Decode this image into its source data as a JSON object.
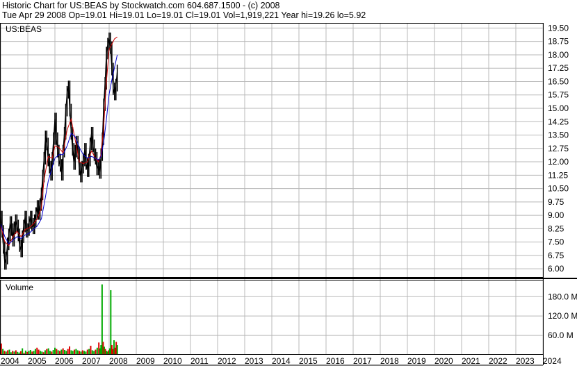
{
  "header": {
    "line1": "Historic Chart for US:BEAS by Stockwatch.com 604.687.1500 - (c) 2008",
    "line2": "Tue Apr 29 2008   Op=19.01   Hi=19.01   Lo=19.01   Cl=19.01   Vol=1,919,221   Year hi=19.26   lo=5.92"
  },
  "chart_data": [
    {
      "type": "line",
      "title": "US:BEAS",
      "y_ticks": [
        "19.50",
        "18.75",
        "18.00",
        "17.25",
        "16.50",
        "15.75",
        "15.00",
        "14.25",
        "13.50",
        "12.75",
        "12.00",
        "11.25",
        "10.50",
        "9.75",
        "9.00",
        "8.25",
        "7.50",
        "6.75",
        "6.00"
      ],
      "ylim": [
        5.5,
        19.75
      ],
      "grid": true,
      "colors": {
        "price": "#000000",
        "ma_short": "#cc0000",
        "ma_long": "#0000cc"
      },
      "series": [
        {
          "key": "price",
          "x": [
            2004.0,
            2004.05,
            2004.1,
            2004.15,
            2004.2,
            2004.25,
            2004.3,
            2004.35,
            2004.4,
            2004.45,
            2004.5,
            2004.55,
            2004.6,
            2004.65,
            2004.7,
            2004.75,
            2004.8,
            2004.85,
            2004.9,
            2004.95,
            2005.0,
            2005.05,
            2005.1,
            2005.15,
            2005.2,
            2005.25,
            2005.3,
            2005.35,
            2005.4,
            2005.45,
            2005.5,
            2005.55,
            2005.6,
            2005.65,
            2005.7,
            2005.75,
            2005.8,
            2005.85,
            2005.9,
            2005.95,
            2006.0,
            2006.05,
            2006.1,
            2006.15,
            2006.2,
            2006.25,
            2006.3,
            2006.35,
            2006.4,
            2006.45,
            2006.5,
            2006.55,
            2006.6,
            2006.65,
            2006.7,
            2006.75,
            2006.8,
            2006.85,
            2006.9,
            2006.95,
            2007.0,
            2007.05,
            2007.1,
            2007.15,
            2007.2,
            2007.25,
            2007.3,
            2007.35,
            2007.4,
            2007.45,
            2007.5,
            2007.55,
            2007.6,
            2007.65,
            2007.7,
            2007.75,
            2007.8,
            2007.85,
            2007.9,
            2007.95,
            2008.0,
            2008.05,
            2008.1,
            2008.15,
            2008.2,
            2008.25,
            2008.3
          ],
          "values": [
            8.9,
            8.1,
            7.2,
            6.3,
            6.6,
            7.4,
            7.9,
            8.6,
            8.2,
            7.6,
            8.3,
            8.7,
            8.4,
            7.9,
            7.3,
            7.0,
            7.8,
            8.4,
            8.9,
            8.1,
            8.2,
            8.6,
            8.9,
            8.5,
            8.3,
            8.7,
            9.1,
            9.5,
            9.1,
            9.6,
            10.2,
            11.2,
            12.2,
            13.4,
            13.0,
            12.1,
            11.7,
            11.3,
            12.2,
            13.3,
            14.4,
            13.3,
            12.6,
            12.1,
            11.8,
            11.3,
            12.6,
            13.6,
            14.9,
            15.9,
            16.2,
            14.9,
            13.6,
            12.7,
            11.9,
            12.6,
            13.1,
            12.5,
            11.6,
            11.2,
            11.7,
            12.1,
            12.7,
            11.9,
            11.5,
            12.1,
            13.0,
            13.6,
            12.9,
            12.4,
            12.2,
            11.6,
            11.8,
            11.4,
            12.4,
            13.3,
            15.2,
            16.4,
            18.1,
            18.6,
            18.9,
            18.4,
            17.2,
            16.1,
            15.8,
            16.3,
            17.1
          ]
        },
        {
          "key": "ma_short",
          "x": [
            2004.0,
            2004.15,
            2004.3,
            2004.45,
            2004.6,
            2004.75,
            2004.9,
            2005.05,
            2005.2,
            2005.35,
            2005.5,
            2005.6,
            2005.75,
            2005.9,
            2006.0,
            2006.15,
            2006.3,
            2006.45,
            2006.6,
            2006.75,
            2006.9,
            2007.05,
            2007.2,
            2007.35,
            2007.5,
            2007.6,
            2007.7,
            2007.8,
            2007.9,
            2008.0,
            2008.1,
            2008.2,
            2008.3
          ],
          "values": [
            8.4,
            7.5,
            7.3,
            7.8,
            8.1,
            7.8,
            8.2,
            8.3,
            8.5,
            8.8,
            9.4,
            11.0,
            12.3,
            12.2,
            12.9,
            12.8,
            12.5,
            13.8,
            14.4,
            13.2,
            12.0,
            11.9,
            12.0,
            12.6,
            12.2,
            12.0,
            12.4,
            14.0,
            16.5,
            18.3,
            18.6,
            18.9,
            19.0
          ]
        },
        {
          "key": "ma_long",
          "x": [
            2004.0,
            2004.15,
            2004.3,
            2004.45,
            2004.6,
            2004.75,
            2004.9,
            2005.05,
            2005.2,
            2005.35,
            2005.5,
            2005.6,
            2005.75,
            2005.9,
            2006.0,
            2006.15,
            2006.3,
            2006.45,
            2006.6,
            2006.75,
            2006.9,
            2007.05,
            2007.2,
            2007.35,
            2007.5,
            2007.6,
            2007.7,
            2007.8,
            2007.9,
            2008.0,
            2008.1,
            2008.2,
            2008.3
          ],
          "values": [
            8.5,
            7.8,
            7.4,
            7.6,
            7.8,
            7.7,
            7.9,
            8.0,
            8.2,
            8.4,
            8.8,
            9.6,
            10.9,
            11.7,
            12.2,
            12.4,
            12.4,
            12.9,
            13.6,
            13.4,
            12.8,
            12.4,
            12.2,
            12.3,
            12.2,
            12.1,
            12.3,
            13.1,
            14.4,
            15.8,
            16.6,
            17.3,
            18.0
          ]
        }
      ]
    },
    {
      "type": "bar",
      "title": "Volume",
      "y_ticks": [
        "180.0 M",
        "120.0 M",
        "60.0 M"
      ],
      "ylim": [
        0,
        230
      ],
      "colors": {
        "up": "#00aa00",
        "down": "#dd0000"
      },
      "x": [
        2004.02,
        2004.08,
        2004.14,
        2004.2,
        2004.26,
        2004.32,
        2004.38,
        2004.44,
        2004.5,
        2004.56,
        2004.62,
        2004.68,
        2004.74,
        2004.8,
        2004.86,
        2004.92,
        2004.98,
        2005.04,
        2005.1,
        2005.16,
        2005.22,
        2005.28,
        2005.34,
        2005.4,
        2005.46,
        2005.52,
        2005.58,
        2005.64,
        2005.7,
        2005.76,
        2005.82,
        2005.88,
        2005.94,
        2006.0,
        2006.06,
        2006.12,
        2006.18,
        2006.24,
        2006.3,
        2006.36,
        2006.42,
        2006.48,
        2006.54,
        2006.6,
        2006.66,
        2006.72,
        2006.78,
        2006.84,
        2006.9,
        2006.96,
        2007.02,
        2007.08,
        2007.14,
        2007.2,
        2007.26,
        2007.32,
        2007.38,
        2007.44,
        2007.5,
        2007.56,
        2007.62,
        2007.66,
        2007.7,
        2007.74,
        2007.78,
        2007.82,
        2007.86,
        2007.9,
        2007.94,
        2007.98,
        2008.02,
        2008.06,
        2008.1,
        2008.14,
        2008.18,
        2008.22,
        2008.26,
        2008.3
      ],
      "values": [
        35,
        18,
        12,
        10,
        14,
        16,
        8,
        12,
        10,
        14,
        9,
        7,
        11,
        20,
        6,
        13,
        9,
        12,
        15,
        10,
        12,
        18,
        22,
        16,
        12,
        10,
        8,
        14,
        18,
        20,
        12,
        10,
        15,
        22,
        18,
        14,
        12,
        16,
        20,
        15,
        12,
        18,
        26,
        14,
        12,
        16,
        18,
        14,
        12,
        10,
        14,
        12,
        10,
        16,
        18,
        28,
        14,
        12,
        16,
        22,
        38,
        20,
        30,
        218,
        40,
        25,
        18,
        12,
        10,
        14,
        20,
        200,
        30,
        18,
        45,
        22,
        40,
        30
      ],
      "up": [
        0,
        1,
        0,
        1,
        0,
        1,
        1,
        0,
        1,
        0,
        1,
        1,
        0,
        1,
        0,
        1,
        0,
        1,
        1,
        0,
        1,
        1,
        0,
        0,
        1,
        1,
        0,
        1,
        0,
        1,
        1,
        0,
        1,
        1,
        0,
        1,
        0,
        1,
        0,
        1,
        1,
        0,
        0,
        1,
        1,
        0,
        1,
        1,
        0,
        1,
        0,
        1,
        1,
        0,
        1,
        0,
        1,
        1,
        0,
        1,
        0,
        1,
        1,
        1,
        0,
        1,
        0,
        1,
        1,
        0,
        1,
        1,
        0,
        0,
        1,
        0,
        0,
        1
      ]
    }
  ],
  "x_axis": {
    "labels": [
      "2004",
      "2005",
      "2006",
      "2007",
      "2008",
      "2009",
      "2010",
      "2011",
      "2012",
      "2013",
      "2014",
      "2015",
      "2016",
      "2017",
      "2018",
      "2019",
      "2020",
      "2021",
      "2022",
      "2023",
      "2024"
    ]
  }
}
